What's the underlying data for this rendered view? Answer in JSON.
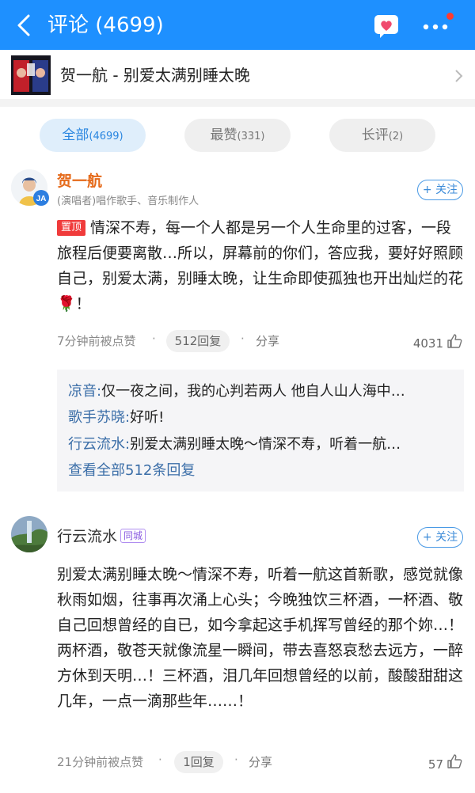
{
  "header": {
    "title": "评论 (4699)",
    "back_icon": "chevron-left-icon",
    "message_icon": "heart-message-icon",
    "more_icon": "more-dots-icon",
    "accent_color": "#1e90ff"
  },
  "song": {
    "title": "贺一航 - 别爱太满别睡太晚",
    "arrow_icon": "chevron-right-icon"
  },
  "tabs": [
    {
      "label": "全部",
      "count": "(4699)",
      "selected": true
    },
    {
      "label": "最赞",
      "count": "(331)",
      "selected": false
    },
    {
      "label": "长评",
      "count": "(2)",
      "selected": false
    }
  ],
  "comments": [
    {
      "user": "贺一航",
      "subtitle": "(演唱者)唱作歌手、音乐制作人",
      "follow_label": "+ 关注",
      "pin_label": "置顶",
      "text": "情深不寿，每一个人都是另一个人生命里的过客，一段旅程后便要离散…所以，屏幕前的你们，答应我，要好好照顾自己，别爱太满，别睡太晚，让生命即使孤独也开出灿烂的花🌹！",
      "time": "7分钟前被点赞",
      "replies_label": "512回复",
      "share_label": "分享",
      "likes": "4031",
      "replies": [
        {
          "user": "凉音:",
          "text": "仅一夜之间，我的心判若两人 他自人山人海中…"
        },
        {
          "user": "歌手苏晓:",
          "text": "好听!"
        },
        {
          "user": "行云流水:",
          "text": "别爱太满别睡太晚～情深不寿，听着一航…"
        }
      ],
      "view_all_label": "查看全部512条回复"
    },
    {
      "user": "行云流水",
      "badge": "同城",
      "follow_label": "+ 关注",
      "text": "别爱太满别睡太晚～情深不寿，听着一航这首新歌，感觉就像秋雨如烟，往事再次涌上心头；今晚独饮三杯酒，一杯酒、敬自己回想曾经的自已，如今拿起这手机挥写曾经的那个妳…！两杯酒，敬苍天就像流星一瞬间，带去喜怒哀愁去远方，一醉方休到天明…！三杯酒，泪几年回想曾经的以前，酸酸甜甜这几年，一点一滴那些年……！",
      "time": "21分钟前被点赞",
      "replies_label": "1回复",
      "share_label": "分享",
      "likes": "57"
    }
  ]
}
